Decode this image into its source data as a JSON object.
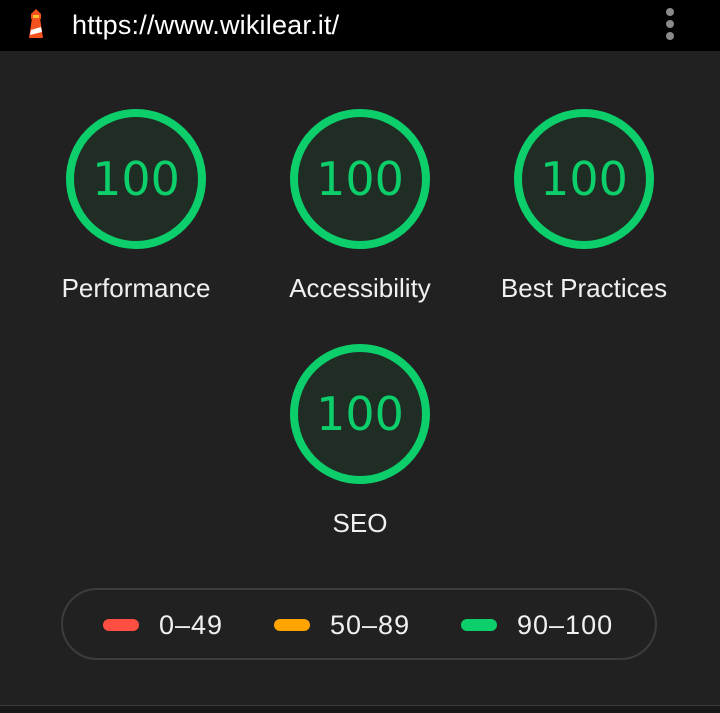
{
  "topbar": {
    "url": "https://www.wikilear.it/",
    "logo_icon": "lighthouse-icon",
    "menu_icon": "more-vert-icon"
  },
  "colors": {
    "background": "#212121",
    "pass": "#0cce6b",
    "average": "#ffa400",
    "fail": "#ff4e42"
  },
  "gauges": [
    {
      "score": "100",
      "label": "Performance"
    },
    {
      "score": "100",
      "label": "Accessibility"
    },
    {
      "score": "100",
      "label": "Best Practices"
    },
    {
      "score": "100",
      "label": "SEO"
    }
  ],
  "legend": [
    {
      "range": "0–49",
      "color": "#ff4e42"
    },
    {
      "range": "50–89",
      "color": "#ffa400"
    },
    {
      "range": "90–100",
      "color": "#0cce6b"
    }
  ]
}
